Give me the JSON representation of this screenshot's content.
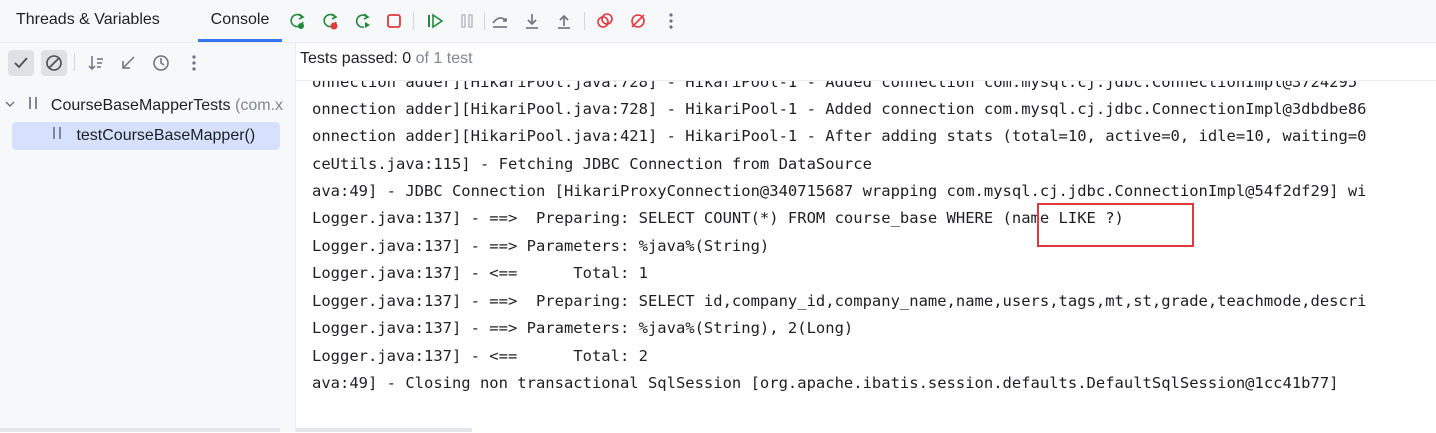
{
  "tabs": [
    {
      "label": "Threads & Variables"
    },
    {
      "label": "Console"
    }
  ],
  "toolbar_icons": [
    "rerun-icon",
    "rerun-failed-icon",
    "toggle-auto-test-icon",
    "stop-icon",
    "resume-icon",
    "pause-icon",
    "step-over-icon",
    "step-into-icon",
    "step-out-icon",
    "view-breakpoints-icon",
    "mute-breakpoints-icon",
    "more-icon"
  ],
  "test_tree": {
    "class_name": "CourseBaseMapperTests",
    "class_pkg": "(com.x",
    "method_name": "testCourseBaseMapper()"
  },
  "status": {
    "label": "Tests passed: ",
    "passed": "0",
    "total": " of 1 test"
  },
  "console_lines": [
    "onnection adder][HikariPool.java:728] - HikariPool-1 - Added connection com.mysql.cj.jdbc.ConnectionImpl@3724295",
    "onnection adder][HikariPool.java:728] - HikariPool-1 - Added connection com.mysql.cj.jdbc.ConnectionImpl@3dbdbe86",
    "onnection adder][HikariPool.java:421] - HikariPool-1 - After adding stats (total=10, active=0, idle=10, waiting=0",
    "ceUtils.java:115] - Fetching JDBC Connection from DataSource",
    "ava:49] - JDBC Connection [HikariProxyConnection@340715687 wrapping com.mysql.cj.jdbc.ConnectionImpl@54f2df29] wi",
    "Logger.java:137] - ==>  Preparing: SELECT COUNT(*) FROM course_base WHERE (name LIKE ?)",
    "Logger.java:137] - ==> Parameters: %java%(String)",
    "Logger.java:137] - <==      Total: 1",
    "Logger.java:137] - ==>  Preparing: SELECT id,company_id,company_name,name,users,tags,mt,st,grade,teachmode,descri",
    "Logger.java:137] - ==> Parameters: %java%(String), 2(Long)",
    "Logger.java:137] - <==      Total: 2",
    "ava:49] - Closing non transactional SqlSession [org.apache.ibatis.session.defaults.DefaultSqlSession@1cc41b77]"
  ],
  "colors": {
    "accent": "#3574f0",
    "green": "#208a3c",
    "red": "#e0393e",
    "gray": "#6c707e"
  }
}
